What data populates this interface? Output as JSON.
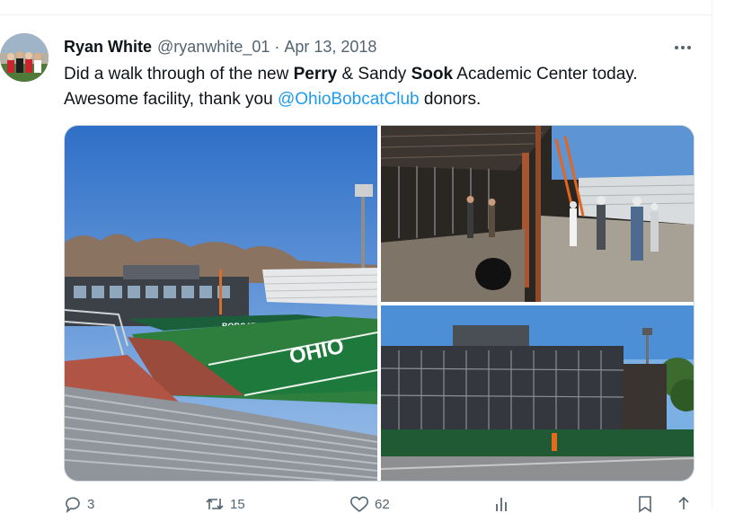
{
  "tweet": {
    "author_name": "Ryan White",
    "author_handle": "@ryanwhite_01",
    "separator": "·",
    "date": "Apr 13, 2018",
    "text": {
      "p1": "Did a walk through of the new ",
      "b1": "Perry",
      "p2": " & Sandy ",
      "b2": "Sook",
      "p3": " Academic Center today.",
      "p4": "Awesome facility, thank you ",
      "mention": "@OhioBobcatClub",
      "p5": " donors."
    },
    "stadium_wall_text": "OHIO",
    "banner_text": "BOBCATS"
  },
  "actions": {
    "replies": "3",
    "reposts": "15",
    "likes": "62"
  },
  "colors": {
    "accent": "#1d9bf0",
    "secondary_text": "#536471",
    "turf": "#1e7a3c"
  },
  "icons": [
    "more-icon",
    "reply-icon",
    "repost-icon",
    "like-icon",
    "views-icon",
    "bookmark-icon",
    "share-icon"
  ]
}
